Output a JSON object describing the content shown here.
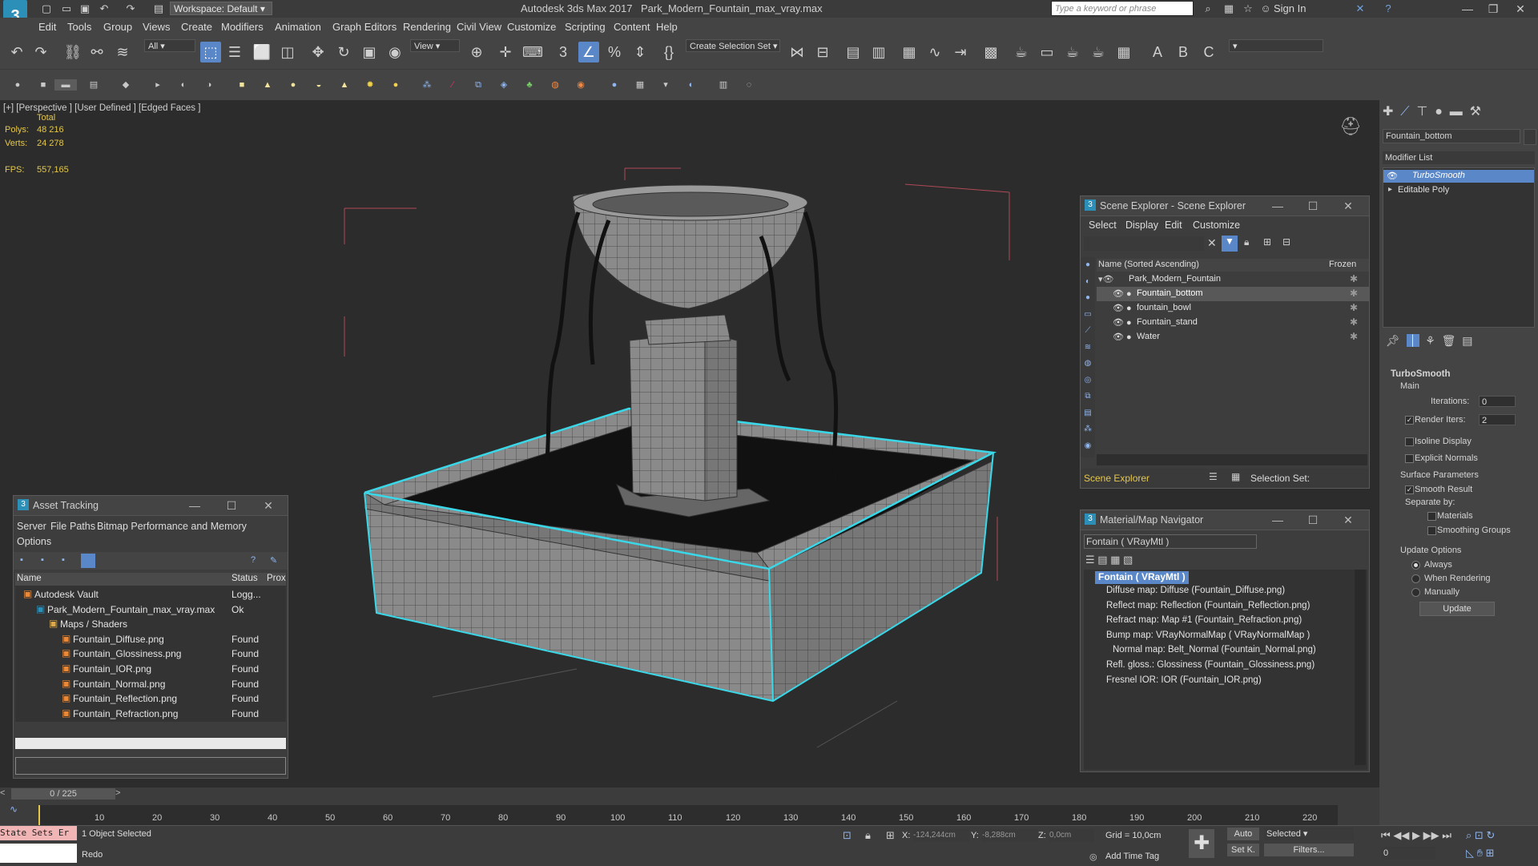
{
  "app": {
    "workspace": "Workspace: Default",
    "title": "Autodesk 3ds Max 2017",
    "file": "Park_Modern_Fountain_max_vray.max",
    "search_placeholder": "Type a keyword or phrase",
    "sign_in": "Sign In"
  },
  "menu": [
    "Edit",
    "Tools",
    "Group",
    "Views",
    "Create",
    "Modifiers",
    "Animation",
    "Graph Editors",
    "Rendering",
    "Civil View",
    "Customize",
    "Scripting",
    "Content",
    "Help"
  ],
  "toolbar": {
    "filter_value": "All",
    "ref_coord": "View",
    "selection_set": "Create Selection Set",
    "chevron_icon": "chevron-down-icon"
  },
  "viewport": {
    "label": "[+] [Perspective ] [User Defined ] [Edged Faces ]",
    "stats_header": "Total",
    "polys_label": "Polys:",
    "polys_value": "48 216",
    "verts_label": "Verts:",
    "verts_value": "24 278",
    "fps_label": "FPS:",
    "fps_value": "557,165"
  },
  "scene_explorer": {
    "title": "Scene Explorer - Scene Explorer",
    "menus": [
      "Select",
      "Display",
      "Edit",
      "Customize"
    ],
    "col_name": "Name (Sorted Ascending)",
    "col_frozen": "Frozen",
    "root": "Park_Modern_Fountain",
    "items": [
      "Fountain_bottom",
      "fountain_bowl",
      "Fountain_stand",
      "Water"
    ],
    "footer_name": "Scene Explorer",
    "selection_set_label": "Selection Set:"
  },
  "asset_tracking": {
    "title": "Asset Tracking",
    "menus": [
      "Server",
      "File",
      "Paths",
      "Bitmap Performance and Memory",
      "Options"
    ],
    "columns": [
      "Name",
      "Status",
      "Prox"
    ],
    "rows": [
      {
        "name": "Autodesk Vault",
        "status": "Logg..."
      },
      {
        "name": "Park_Modern_Fountain_max_vray.max",
        "status": "Ok"
      },
      {
        "name": "Maps / Shaders",
        "status": ""
      },
      {
        "name": "Fountain_Diffuse.png",
        "status": "Found"
      },
      {
        "name": "Fountain_Glossiness.png",
        "status": "Found"
      },
      {
        "name": "Fountain_IOR.png",
        "status": "Found"
      },
      {
        "name": "Fountain_Normal.png",
        "status": "Found"
      },
      {
        "name": "Fountain_Reflection.png",
        "status": "Found"
      },
      {
        "name": "Fountain_Refraction.png",
        "status": "Found"
      }
    ]
  },
  "material_nav": {
    "title": "Material/Map Navigator",
    "current": "Fontain ( VRayMtl )",
    "root": "Fontain ( VRayMtl )",
    "maps": [
      "Diffuse map: Diffuse (Fountain_Diffuse.png)",
      "Reflect map: Reflection (Fountain_Reflection.png)",
      "Refract map: Map #1 (Fountain_Refraction.png)",
      "Bump map: VRayNormalMap ( VRayNormalMap )",
      "Normal map: Belt_Normal (Fountain_Normal.png)",
      "Refl. gloss.: Glossiness (Fountain_Glossiness.png)",
      "Fresnel IOR: IOR (Fountain_IOR.png)"
    ]
  },
  "command_panel": {
    "object_name": "Fountain_bottom",
    "modifier_list": "Modifier List",
    "stack": [
      "TurboSmooth",
      "Editable Poly"
    ],
    "rollout": "TurboSmooth",
    "main": "Main",
    "iterations_label": "Iterations:",
    "iterations_value": "0",
    "render_iters_label": "Render Iters:",
    "render_iters_value": "2",
    "isoline": "Isoline Display",
    "explicit": "Explicit Normals",
    "surface_params": "Surface Parameters",
    "smooth_result": "Smooth Result",
    "separate_by": "Separate by:",
    "materials": "Materials",
    "smoothing_groups": "Smoothing Groups",
    "update_options": "Update Options",
    "always": "Always",
    "when_rendering": "When Rendering",
    "manually": "Manually",
    "update_btn": "Update"
  },
  "timeline": {
    "frame": "0 / 225",
    "ticks": [
      "10",
      "20",
      "30",
      "40",
      "50",
      "60",
      "70",
      "80",
      "90",
      "100",
      "110",
      "120",
      "130",
      "140",
      "150",
      "160",
      "170",
      "180",
      "190",
      "200",
      "210",
      "220"
    ]
  },
  "status": {
    "state_sets": "State Sets Er",
    "selected": "1 Object Selected",
    "undo": "Redo",
    "x_label": "X:",
    "x_value": "-124,244cm",
    "y_label": "Y:",
    "y_value": "-8,288cm",
    "z_label": "Z:",
    "z_value": "0,0cm",
    "grid": "Grid = 10,0cm",
    "add_time_tag": "Add Time Tag",
    "auto": "Auto",
    "selected_drop": "Selected",
    "setk": "Set K.",
    "filters": "Filters...",
    "frame_value": "0"
  },
  "colors": {
    "accent": "#5a87c7",
    "selection": "#3ad7e8",
    "stats": "#e5c84b"
  }
}
